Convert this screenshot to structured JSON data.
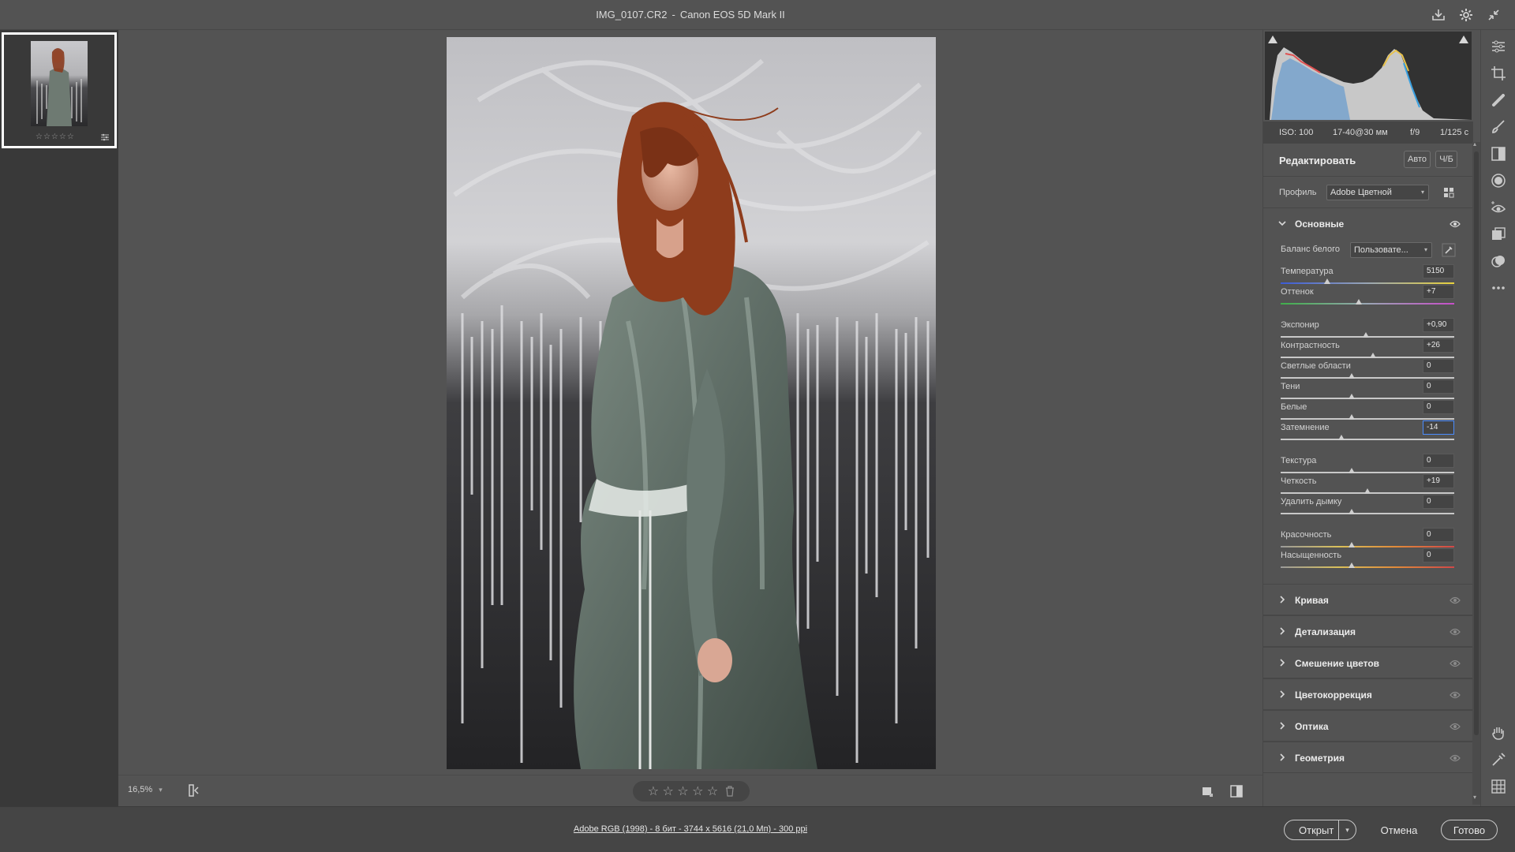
{
  "titlebar": {
    "filename": "IMG_0107.CR2",
    "separator": "-",
    "camera": "Canon EOS 5D Mark II",
    "icons": [
      "save-icon",
      "gear-icon",
      "collapse-icon"
    ]
  },
  "filmstrip": {
    "thumbnails": [
      {
        "rating": "☆☆☆☆☆"
      }
    ]
  },
  "viewer": {
    "zoom": "16,5%",
    "rating_stars": "☆ ☆ ☆ ☆ ☆"
  },
  "histogram": {
    "exif": {
      "iso": "ISO: 100",
      "lens": "17-40@30 мм",
      "aperture": "f/9",
      "shutter": "1/125 с"
    }
  },
  "editor": {
    "title": "Редактировать",
    "auto_label": "Авто",
    "bw_label": "Ч/Б",
    "profile_label": "Профиль",
    "profile_value": "Adobe Цветной",
    "basic": {
      "title": "Основные",
      "wb_label": "Баланс белого",
      "wb_value": "Пользовате...",
      "sliders": [
        {
          "label": "Температура",
          "value": "5150",
          "pos": 0.27,
          "track": "temp"
        },
        {
          "label": "Оттенок",
          "value": "+7",
          "pos": 0.45,
          "track": "tint"
        },
        {
          "label": "Экспонир",
          "value": "+0,90",
          "pos": 0.49,
          "track": "plain"
        },
        {
          "label": "Контрастность",
          "value": "+26",
          "pos": 0.53,
          "track": "plain"
        },
        {
          "label": "Светлые области",
          "value": "0",
          "pos": 0.41,
          "track": "plain"
        },
        {
          "label": "Тени",
          "value": "0",
          "pos": 0.41,
          "track": "plain"
        },
        {
          "label": "Белые",
          "value": "0",
          "pos": 0.41,
          "track": "plain"
        },
        {
          "label": "Затемнение",
          "value": "-14",
          "pos": 0.35,
          "track": "plain",
          "focus": true
        },
        {
          "label": "Текстура",
          "value": "0",
          "pos": 0.41,
          "track": "plain"
        },
        {
          "label": "Четкость",
          "value": "+19",
          "pos": 0.5,
          "track": "plain"
        },
        {
          "label": "Удалить дымку",
          "value": "0",
          "pos": 0.41,
          "track": "plain"
        },
        {
          "label": "Красочность",
          "value": "0",
          "pos": 0.41,
          "track": "vib"
        },
        {
          "label": "Насыщенность",
          "value": "0",
          "pos": 0.41,
          "track": "vib"
        }
      ]
    },
    "sections": [
      "Кривая",
      "Детализация",
      "Смешение цветов",
      "Цветокоррекция",
      "Оптика",
      "Геометрия"
    ]
  },
  "footer": {
    "info": "Adobe RGB (1998) - 8 бит - 3744 x 5616 (21,0 Мп) - 300 ppi",
    "open_label": "Открыт",
    "cancel_label": "Отмена",
    "done_label": "Готово"
  },
  "toolbar": {
    "tools": [
      "sliders-icon",
      "crop-icon",
      "healing-brush-icon",
      "brush-icon",
      "gradient-icon",
      "radial-filter-icon",
      "red-eye-icon",
      "snapshots-icon",
      "presets-icon",
      "more-icon",
      "hand-icon",
      "eyedropper-icon",
      "grid-icon"
    ]
  }
}
